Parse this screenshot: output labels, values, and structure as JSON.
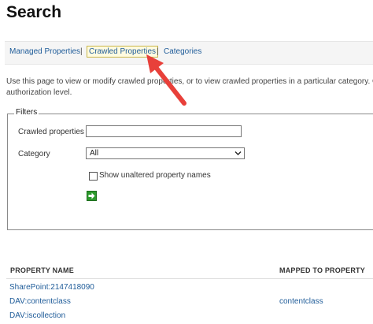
{
  "page": {
    "title": "Search"
  },
  "nav": {
    "managed": "Managed Properties",
    "sep1": "|",
    "crawled": "Crawled Properties",
    "sep2": "|",
    "categories": "Categories"
  },
  "intro": {
    "line1": "Use this page to view or modify crawled properties, or to view crawled properties in a particular category. Cha",
    "line2": "authorization level."
  },
  "filters": {
    "legend": "Filters",
    "crawled_label": "Crawled properties",
    "crawled_value": "",
    "category_label": "Category",
    "category_value": "All",
    "show_unaltered_label": "Show unaltered property names",
    "show_unaltered_checked": false
  },
  "table": {
    "headers": {
      "property_name": "PROPERTY NAME",
      "mapped_to": "MAPPED TO PROPERTY"
    },
    "rows": [
      {
        "name": "SharePoint:2147418090",
        "mapped": ""
      },
      {
        "name": "DAV:contentclass",
        "mapped": "contentclass"
      },
      {
        "name": "DAV:iscollection",
        "mapped": ""
      }
    ]
  },
  "annotation": {
    "arrow_color": "#e8403a"
  }
}
